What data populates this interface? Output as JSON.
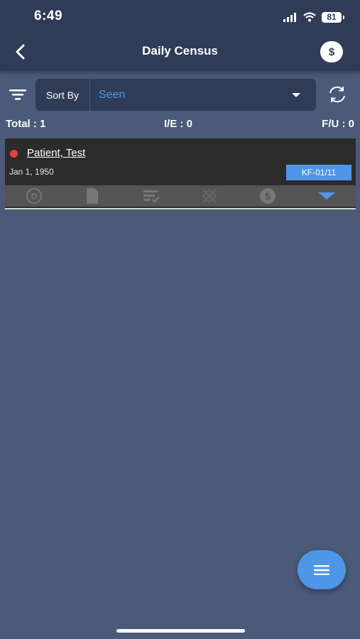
{
  "status_bar": {
    "time": "6:49",
    "battery": "81"
  },
  "header": {
    "title": "Daily Census",
    "dollar_symbol": "$"
  },
  "sort": {
    "label": "Sort By",
    "value": "Seen"
  },
  "counts": {
    "total": "Total : 1",
    "ie": "I/E : 0",
    "fu": "F/U : 0"
  },
  "patients": [
    {
      "name": "Patient, Test",
      "dob": "Jan 1, 1950",
      "tag": "KF-01/11",
      "status_color": "#e0453a"
    }
  ],
  "colors": {
    "accent": "#4f97e6",
    "header_bg": "#2f3c57",
    "page_bg": "#4a5a78",
    "card_bg": "#2b2b2b",
    "status_dot": "#e0453a"
  },
  "icons": {
    "back": "chevron-left-icon",
    "dollar": "dollar-icon",
    "filter": "filter-icon",
    "refresh": "refresh-icon",
    "fab": "menu-icon",
    "actions": [
      "d-circle-icon",
      "document-icon",
      "list-check-icon",
      "grid-icon",
      "dollar-circle-icon",
      "expand-down-icon"
    ]
  }
}
